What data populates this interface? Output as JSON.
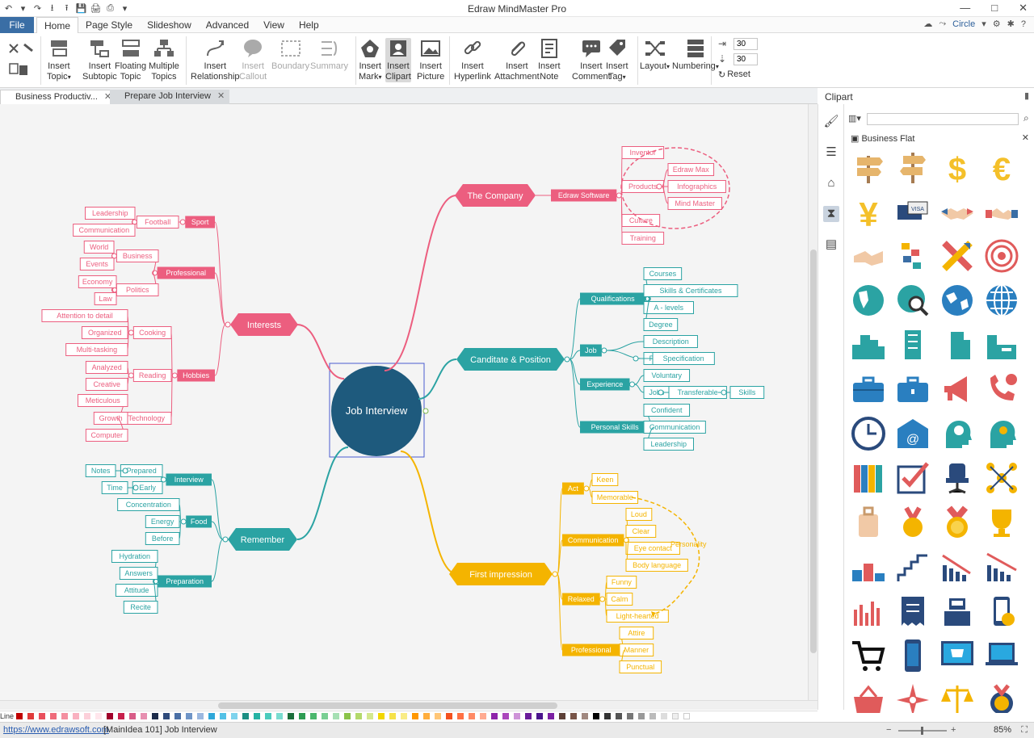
{
  "window": {
    "title": "Edraw MindMaster Pro",
    "controls": [
      "—",
      "□",
      "✕"
    ]
  },
  "quick_access": [
    "↶",
    "▾",
    "↷",
    "⭳",
    "⭱",
    "💾",
    "🖨",
    "⎙",
    "▾"
  ],
  "menu": {
    "file": "File",
    "tabs": [
      "Home",
      "Page Style",
      "Slideshow",
      "Advanced",
      "View",
      "Help"
    ],
    "active_tab": "Home",
    "right": {
      "circle": "Circle"
    }
  },
  "ribbon": {
    "buttons": [
      {
        "id": "insert-topic",
        "label": "Insert\nTopic",
        "dropdown": true
      },
      {
        "id": "insert-subtopic",
        "label": "Insert\nSubtopic"
      },
      {
        "id": "floating-topic",
        "label": "Floating\nTopic"
      },
      {
        "id": "multiple-topics",
        "label": "Multiple\nTopics"
      },
      {
        "id": "insert-relationship",
        "label": "Insert\nRelationship"
      },
      {
        "id": "insert-callout",
        "label": "Insert\nCallout",
        "disabled": true
      },
      {
        "id": "boundary",
        "label": "Boundary",
        "disabled": true
      },
      {
        "id": "summary",
        "label": "Summary",
        "disabled": true
      },
      {
        "id": "insert-mark",
        "label": "Insert\nMark",
        "dropdown": true
      },
      {
        "id": "insert-clipart",
        "label": "Insert\nClipart",
        "selected": true
      },
      {
        "id": "insert-picture",
        "label": "Insert\nPicture"
      },
      {
        "id": "insert-hyperlink",
        "label": "Insert\nHyperlink"
      },
      {
        "id": "insert-attachment",
        "label": "Insert\nAttachment"
      },
      {
        "id": "insert-note",
        "label": "Insert\nNote"
      },
      {
        "id": "insert-comment",
        "label": "Insert\nComment"
      },
      {
        "id": "insert-tag",
        "label": "Insert\nTag",
        "dropdown": true
      },
      {
        "id": "layout",
        "label": "Layout",
        "dropdown": true
      },
      {
        "id": "numbering",
        "label": "Numbering",
        "dropdown": true
      }
    ],
    "spin1": "30",
    "spin2": "30",
    "reset": "Reset"
  },
  "doc_tabs": [
    {
      "label": "Business Productiv...",
      "active": true
    },
    {
      "label": "Prepare Job Interview",
      "active": false
    }
  ],
  "panel": {
    "title": "Clipart",
    "category": "Business Flat"
  },
  "clipart_icons": [
    "signpost-icon",
    "direction-sign-icon",
    "dollar-icon",
    "euro-icon",
    "yen-icon",
    "credit-card-icon",
    "handshake-icon",
    "handshake-alt-icon",
    "handshake-deal-icon",
    "puzzle-icon",
    "crossed-pencils-icon",
    "target-icon",
    "globe-americas-icon",
    "globe-search-icon",
    "globe-world-icon",
    "globe-grid-icon",
    "city-icon",
    "skyscraper-icon",
    "tower-icon",
    "factory-icon",
    "briefcase-icon",
    "briefcase-alt-icon",
    "megaphone-icon",
    "phone-call-icon",
    "clock-icon",
    "email-icon",
    "gear-head-icon",
    "idea-head-icon",
    "binders-icon",
    "checkbox-icon",
    "office-chair-icon",
    "network-icon",
    "suitcase-icon",
    "medal-icon",
    "medal-gold-icon",
    "trophy-icon",
    "podium-icon",
    "stairs-icon",
    "decline-chart-icon",
    "decline-chart-alt-icon",
    "bar-chart-icon",
    "receipt-icon",
    "cash-register-icon",
    "mobile-payment-icon",
    "shopping-cart-icon",
    "mobile-icon",
    "online-shop-icon",
    "laptop-shop-icon",
    "basket-icon",
    "compass-arrows-icon",
    "scales-icon",
    "award-icon"
  ],
  "mindmap": {
    "root": "Job Interview",
    "company": {
      "label": "The Company",
      "child": "Edraw Software",
      "leaves": [
        "Inventor",
        "Products",
        "Culture",
        "Training"
      ],
      "products": [
        "Edraw Max",
        "Infographics",
        "Mind Master"
      ]
    },
    "position": {
      "label": "Canditate & Position",
      "qualifications": {
        "label": "Qualifications",
        "items": [
          "Courses",
          "Skills & Certificates",
          "A - levels",
          "Degree"
        ]
      },
      "job": {
        "label": "Job",
        "items": [
          "Description",
          "Person"
        ],
        "person_child": "Specification"
      },
      "experience": {
        "label": "Experience",
        "items": [
          "Voluntary",
          "Jobs"
        ],
        "jobs_child": "Transferable",
        "transferable_child": "Skills"
      },
      "personal": {
        "label": "Personal Skills",
        "items": [
          "Confident",
          "Communication",
          "Leadership"
        ]
      }
    },
    "impression": {
      "label": "First impression",
      "act": {
        "label": "Act",
        "items": [
          "Keen",
          "Memorable"
        ]
      },
      "communication": {
        "label": "Communication",
        "items": [
          "Loud",
          "Clear",
          "Eye contact",
          "Body language"
        ]
      },
      "relaxed": {
        "label": "Relaxed",
        "items": [
          "Funny",
          "Calm",
          "Light-hearted"
        ]
      },
      "professional": {
        "label": "Professional",
        "items": [
          "Attire",
          "Manner",
          "Punctual"
        ]
      },
      "callout": "Personality"
    },
    "interests": {
      "label": "Interests",
      "sport": {
        "label": "Sport",
        "football": "Football",
        "items": [
          "Leadership",
          "Communication"
        ]
      },
      "professional": {
        "label": "Professional",
        "business": "Business",
        "business_items": [
          "World",
          "Events"
        ],
        "politics": "Politics",
        "politics_items": [
          "Economy",
          "Law"
        ]
      },
      "hobbies": {
        "label": "Hobbies",
        "cooking": "Cooking",
        "cooking_items": [
          "Attention to detail",
          "Organized",
          "Multi-tasking"
        ],
        "reading": "Reading",
        "reading_items": [
          "Analyzed",
          "Creative"
        ],
        "technology": "Technology",
        "technology_items": [
          "Meticulous",
          "Growth",
          "Computer"
        ]
      }
    },
    "remember": {
      "label": "Remember",
      "interview": {
        "label": "Interview",
        "items": [
          "Prepared",
          "Early"
        ],
        "notes": "Notes",
        "time": "Time"
      },
      "food": {
        "label": "Food",
        "items": [
          "Concentration",
          "Energy",
          "Before"
        ]
      },
      "preparation": {
        "label": "Preparation",
        "items": [
          "Hydration",
          "Answers",
          "Attitude",
          "Recite"
        ]
      }
    }
  },
  "palette": {
    "label": "Line"
  },
  "status": {
    "url": "https://www.edrawsoft.com",
    "info": "[MainIdea 101]  Job Interview",
    "zoom": "85%"
  },
  "colors": {
    "root": "#1e5a7d",
    "company": "#ec5e7f",
    "position": "#2ba3a3",
    "impression": "#f4b400",
    "interests": "#ec5e7f",
    "remember": "#2ba3a3",
    "file_tab": "#3a6ea5"
  }
}
